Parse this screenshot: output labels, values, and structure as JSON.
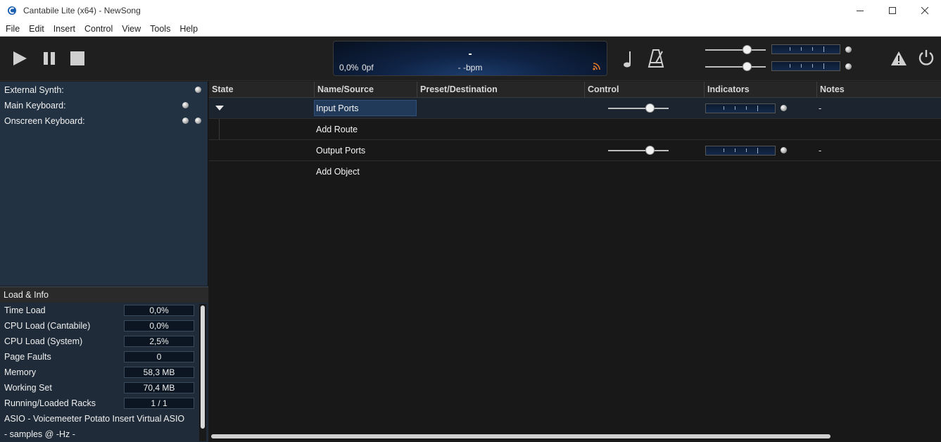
{
  "window": {
    "title": "Cantabile Lite (x64) - NewSong"
  },
  "menu": [
    "File",
    "Edit",
    "Insert",
    "Control",
    "View",
    "Tools",
    "Help"
  ],
  "display": {
    "song_title": "-",
    "position": "0,0%",
    "page_faults": "0pf",
    "tempo": "- -bpm"
  },
  "toolbar": {
    "slider1_level": 0.73,
    "slider2_level": 0.73
  },
  "sidebar": {
    "items": [
      {
        "label": "External Synth:"
      },
      {
        "label": "Main Keyboard:"
      },
      {
        "label": "Onscreen Keyboard:"
      }
    ]
  },
  "load_info": {
    "title": "Load & Info",
    "rows": [
      {
        "label": "Time Load",
        "value": "0,0%"
      },
      {
        "label": "CPU Load (Cantabile)",
        "value": "0,0%"
      },
      {
        "label": "CPU Load (System)",
        "value": "2,5%"
      },
      {
        "label": "Page Faults",
        "value": "0"
      },
      {
        "label": "Memory",
        "value": "58,3 MB"
      },
      {
        "label": "Working Set",
        "value": "70,4 MB"
      },
      {
        "label": "Running/Loaded Racks",
        "value": "1 / 1"
      }
    ],
    "driver": "ASIO - Voicemeeter Potato Insert Virtual ASIO",
    "samples": "- samples @ -Hz -"
  },
  "table": {
    "columns": [
      "State",
      "Name/Source",
      "Preset/Destination",
      "Control",
      "Indicators",
      "Notes"
    ],
    "rows": [
      {
        "name": "Input Ports",
        "note": "-",
        "level": 0.73
      },
      {
        "name": "Add Route",
        "note": ""
      },
      {
        "name": "Output Ports",
        "note": "-",
        "level": 0.73
      },
      {
        "name": "Add Object",
        "note": ""
      }
    ]
  },
  "colors": {
    "accent_rss": "#e0782a",
    "selection": "#223a5a",
    "panel": "#223242"
  }
}
